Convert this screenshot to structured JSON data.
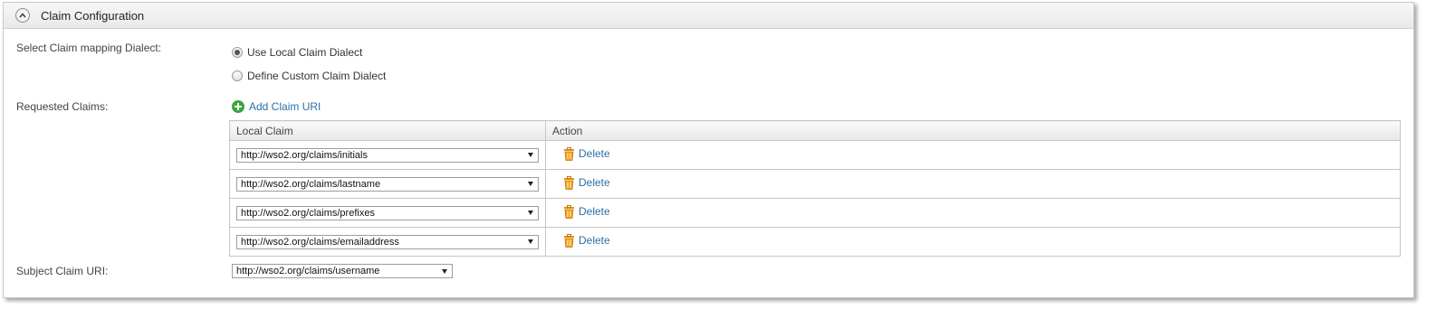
{
  "section": {
    "title": "Claim Configuration"
  },
  "dialect": {
    "label": "Select Claim mapping Dialect:",
    "options": [
      {
        "label": "Use Local Claim Dialect",
        "checked": true
      },
      {
        "label": "Define Custom Claim Dialect",
        "checked": false
      }
    ]
  },
  "requested": {
    "label": "Requested Claims:",
    "add_label": "Add Claim URI",
    "columns": {
      "local_claim": "Local Claim",
      "action": "Action"
    },
    "rows": [
      {
        "claim": "http://wso2.org/claims/initials",
        "action": "Delete"
      },
      {
        "claim": "http://wso2.org/claims/lastname",
        "action": "Delete"
      },
      {
        "claim": "http://wso2.org/claims/prefixes",
        "action": "Delete"
      },
      {
        "claim": "http://wso2.org/claims/emailaddress",
        "action": "Delete"
      }
    ]
  },
  "subject": {
    "label": "Subject Claim URI:",
    "value": "http://wso2.org/claims/username"
  },
  "icons": {
    "collapse": "chevron-up-circle-icon",
    "add": "plus-circle-icon",
    "delete": "trash-icon"
  },
  "colors": {
    "link": "#2c6fa6",
    "add_icon": "#3da33d",
    "trash_icon": "#e8920f"
  }
}
